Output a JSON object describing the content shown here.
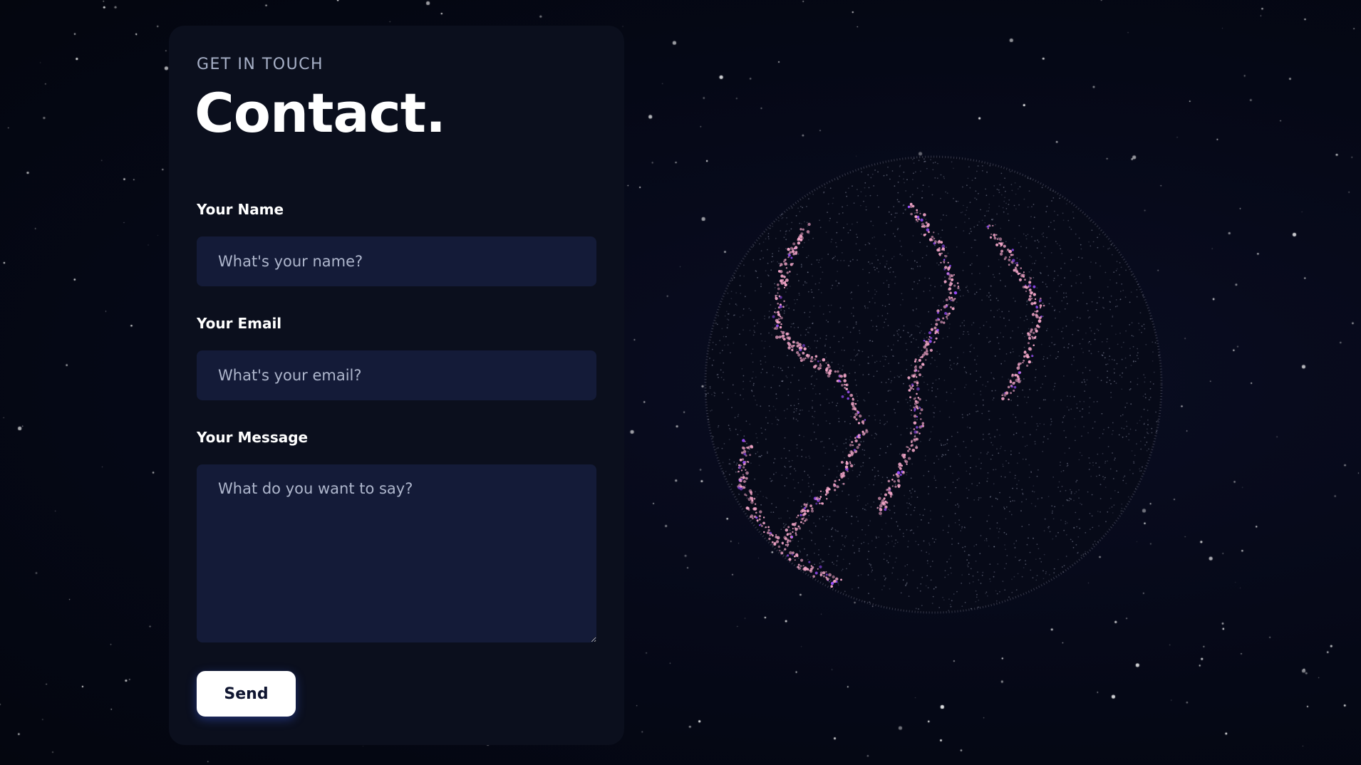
{
  "contact": {
    "subtitle": "GET IN TOUCH",
    "title": "Contact.",
    "name_label": "Your Name",
    "name_placeholder": "What's your name?",
    "email_label": "Your Email",
    "email_placeholder": "What's your email?",
    "message_label": "Your Message",
    "message_placeholder": "What do you want to say?",
    "send_label": "Send"
  },
  "globe": {
    "description_icon": "earth-globe-icon",
    "accent_color": "#f3a6c8",
    "highlight_color": "#9b4dff"
  },
  "colors": {
    "background": "#050816",
    "card": "#0b0f1d",
    "input": "#141b38",
    "button": "#ffffff"
  }
}
